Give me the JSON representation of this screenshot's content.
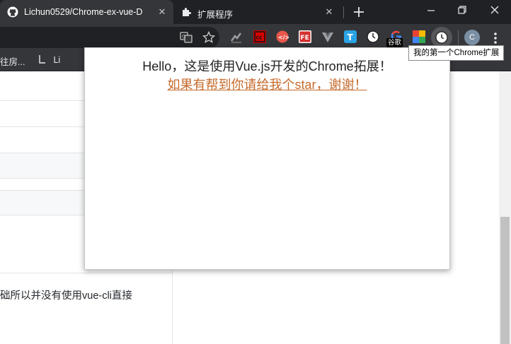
{
  "tabs": [
    {
      "title": "Lichun0529/Chrome-ex-vue-D",
      "active": true,
      "favicon": "github-icon"
    },
    {
      "title": "扩展程序",
      "active": false,
      "favicon": "puzzle-icon"
    }
  ],
  "window_controls": [
    "minimize-icon",
    "restore-icon",
    "close-icon"
  ],
  "toolbar": {
    "extensions": [
      "translate-icon",
      "bookmark-star-icon",
      "cloud-ext-icon",
      "cc-ext-icon",
      "code-ext-icon",
      "fe-ext-icon",
      "vue-devtools-icon",
      "t-ext-icon",
      "clock-ext-icon",
      "google-ext-icon",
      "grid-ext-icon",
      "chrome-ex-vue-icon"
    ],
    "badge_text": "谷歌",
    "avatar_letter": "C"
  },
  "bookmarks": {
    "item1": "往房...",
    "item2": "Li"
  },
  "page": {
    "text_line": "础所以并没有使用vue-cli直接"
  },
  "popup": {
    "hello_text": "Hello，这是使用Vue.js开发的Chrome拓展！",
    "link_text": "如果有帮到你请给我个star，谢谢！"
  },
  "tooltip": {
    "text": "我的第一个Chrome扩展"
  },
  "colors": {
    "tabbar": "#202124",
    "toolbar": "#35363a",
    "link": "#c66a2b"
  }
}
